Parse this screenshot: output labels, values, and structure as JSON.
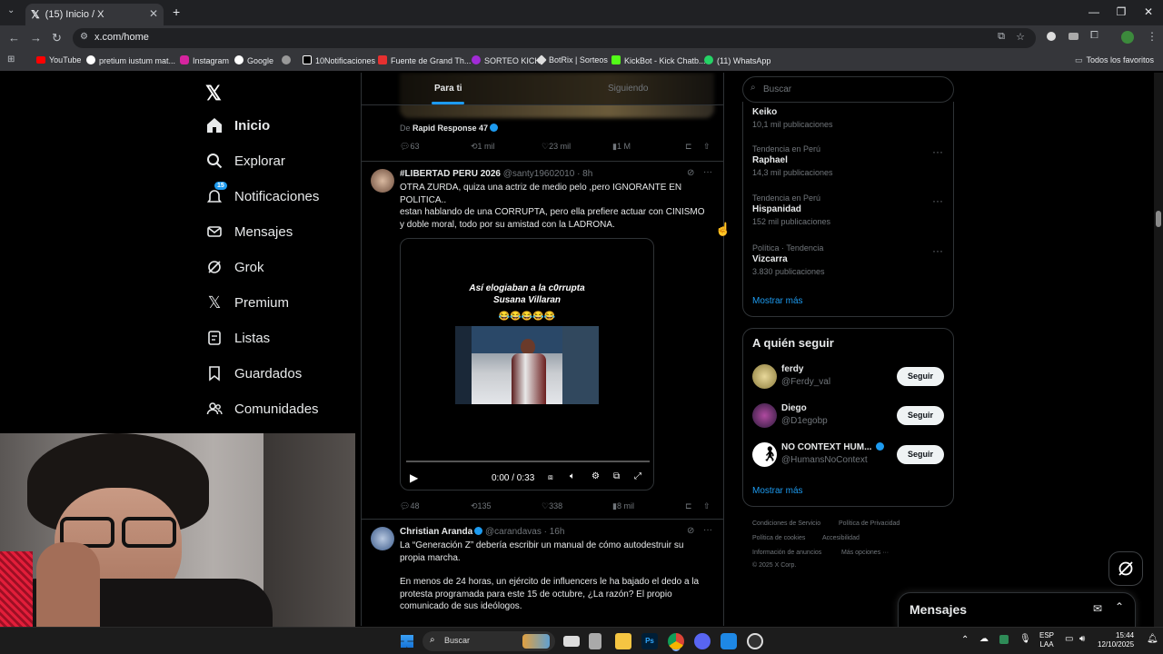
{
  "browser": {
    "tab_title": "(15) Inicio / X",
    "url": "x.com/home",
    "bookmarks": [
      "YouTube",
      "pretium iustum mat...",
      "Instagram",
      "Google",
      "",
      "10Notificaciones",
      "Fuente de Grand Th...",
      "SORTEO KICK",
      "BotRix | Sorteos",
      "KickBot - Kick Chatb...",
      "(11) WhatsApp"
    ],
    "all_bookmarks": "Todos los favoritos"
  },
  "nav": {
    "home": "Inicio",
    "explore": "Explorar",
    "notifications": "Notificaciones",
    "notif_badge": "15",
    "messages": "Mensajes",
    "grok": "Grok",
    "premium": "Premium",
    "lists": "Listas",
    "saved": "Guardados",
    "communities": "Comunidades"
  },
  "feed": {
    "tab_for_you": "Para ti",
    "tab_following": "Siguiendo",
    "t0": {
      "from_prefix": "De",
      "from": "Rapid Response 47",
      "replies": "63",
      "reposts": "1 mil",
      "likes": "23 mil",
      "views": "1 M"
    },
    "t1": {
      "name": "#LIBERTAD PERU 2026",
      "handle": "@santy19602010",
      "time": "· 8h",
      "line1": "OTRA ZURDA, quiza una actriz de medio pelo ,pero IGNORANTE EN",
      "line2": "POLITICA..",
      "line3": "estan hablando de una CORRUPTA, pero ella prefiere actuar con CINISMO",
      "line4": "y doble moral, todo por su amistad con la LADRONA.",
      "video_title1": "Así elogiaban a la c0rrupta",
      "video_title2": "Susana Villaran",
      "video_emoji": "😂😂😂😂😂",
      "video_time": "0:00 / 0:33",
      "replies": "48",
      "reposts": "135",
      "likes": "338",
      "views": "8 mil"
    },
    "t2": {
      "name": "Christian Aranda",
      "handle": "@carandavas",
      "time": "· 16h",
      "line1": "La “Generación Z” debería escribir un manual de cómo autodestruir su",
      "line2": "propia marcha.",
      "line3": "En menos de 24 horas, un ejército de influencers le ha bajado el dedo a la",
      "line4": "protesta programada para este 15 de octubre, ¿La razón? El propio",
      "line5": "comunicado de sus ideólogos."
    }
  },
  "right": {
    "search_placeholder": "Buscar",
    "trends": [
      {
        "meta": "",
        "name": "Keiko",
        "count": "10,1 mil publicaciones"
      },
      {
        "meta": "Tendencia en Perú",
        "name": "Raphael",
        "count": "14,3 mil publicaciones"
      },
      {
        "meta": "Tendencia en Perú",
        "name": "Hispanidad",
        "count": "152 mil publicaciones"
      },
      {
        "meta": "Política · Tendencia",
        "name": "Vizcarra",
        "count": "3.830 publicaciones"
      }
    ],
    "show_more": "Mostrar más",
    "who_to_follow": "A quién seguir",
    "follow": [
      {
        "name": "ferdy",
        "handle": "@Ferdy_val",
        "btn": "Seguir"
      },
      {
        "name": "Diego",
        "handle": "@D1egobp",
        "btn": "Seguir"
      },
      {
        "name": "NO CONTEXT HUM...",
        "handle": "@HumansNoContext",
        "btn": "Seguir"
      }
    ],
    "show_more2": "Mostrar más",
    "footer": {
      "terms": "Condiciones de Servicio",
      "privacy": "Política de Privacidad",
      "cookies": "Política de cookies",
      "access": "Accesibilidad",
      "ads": "Información de anuncios",
      "more": "Más opciones ···",
      "copy": "© 2025 X Corp."
    }
  },
  "messages_title": "Mensajes",
  "taskbar": {
    "search": "Buscar",
    "lang1": "ESP",
    "lang2": "LAA",
    "time": "15:44",
    "date": "12/10/2025"
  },
  "colors": {
    "accent": "#1d9bf0",
    "bg": "#000000",
    "border": "#2f3336"
  }
}
